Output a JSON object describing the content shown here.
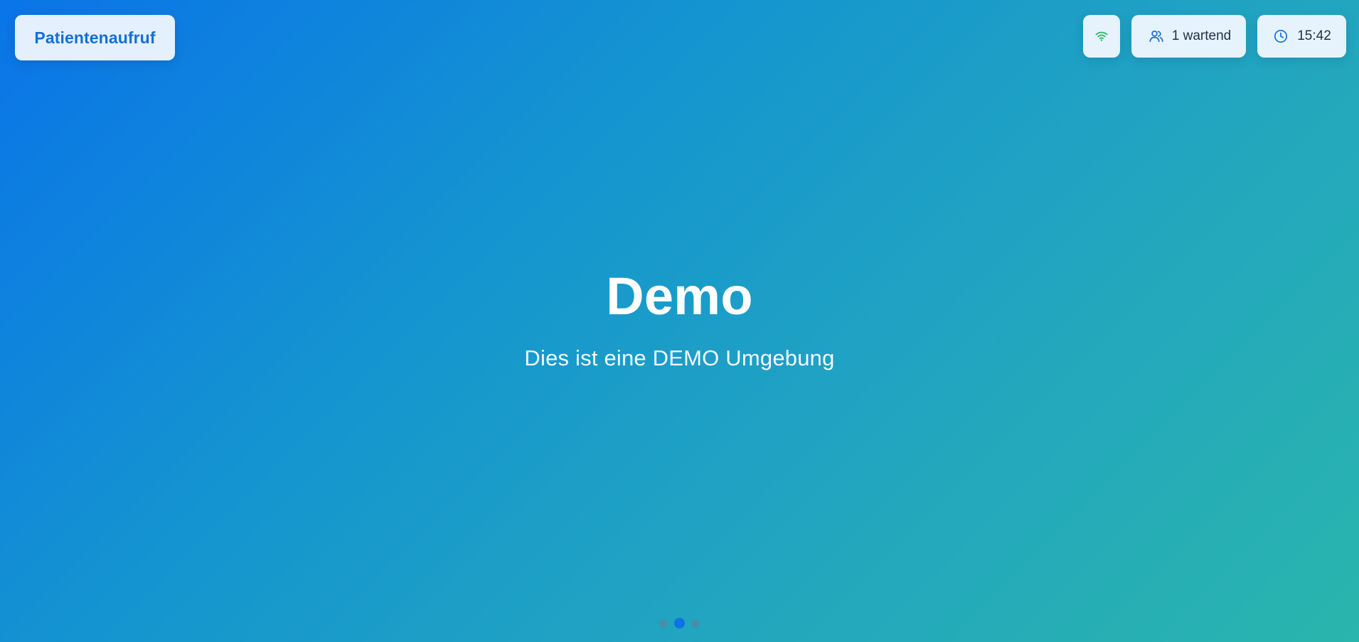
{
  "header": {
    "brand_label": "Patientenaufruf"
  },
  "status": {
    "connection_icon": "wifi-icon",
    "connection_color": "#31b866",
    "waiting_icon": "users-icon",
    "waiting_text": "1 wartend",
    "time_icon": "clock-icon",
    "time_text": "15:42"
  },
  "slide": {
    "title": "Demo",
    "subtitle": "Dies ist eine DEMO Umgebung"
  },
  "pagination": {
    "total": 3,
    "active": 2
  },
  "colors": {
    "brand_text": "#1170d9",
    "accent_blue": "#0b72e8",
    "gradient_start": "#0a74e8",
    "gradient_end": "#2ab5ad"
  }
}
